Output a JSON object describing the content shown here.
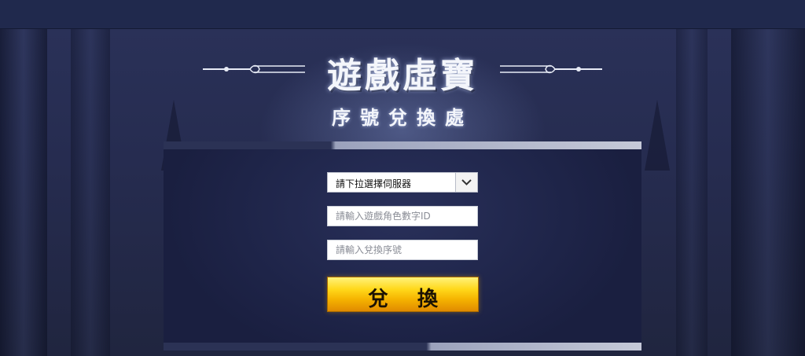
{
  "title": {
    "main": "遊戲虛寶",
    "sub": "序號兌換處"
  },
  "form": {
    "server_select": {
      "selected": "請下拉選擇伺服器"
    },
    "role_id": {
      "placeholder": "請輸入遊戲角色數字ID"
    },
    "serial": {
      "placeholder": "請輸入兌換序號"
    },
    "submit_label": "兌 換"
  },
  "icons": {
    "dropdown": "chevron-down-icon",
    "ornament": "flourish-ornament-icon"
  },
  "colors": {
    "background": "#1e2442",
    "button_top": "#fff27a",
    "button_bottom": "#e08a00",
    "title": "#f4f6fb"
  }
}
